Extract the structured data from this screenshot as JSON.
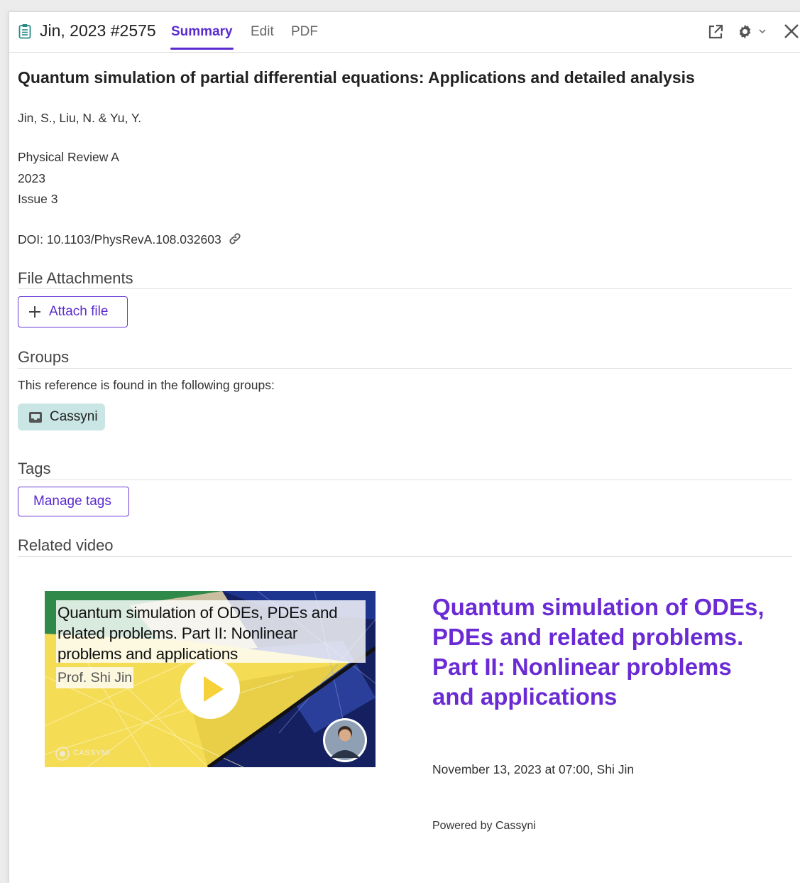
{
  "header": {
    "ref_title": "Jin, 2023 #2575",
    "tabs": [
      {
        "label": "Summary",
        "active": true
      },
      {
        "label": "Edit",
        "active": false
      },
      {
        "label": "PDF",
        "active": false
      }
    ],
    "icons": [
      "open-external-icon",
      "gear-icon",
      "chevron-down-icon",
      "close-icon"
    ]
  },
  "reference": {
    "title": "Quantum simulation of partial differential equations: Applications and detailed analysis",
    "authors": "Jin, S., Liu, N. & Yu, Y.",
    "journal": "Physical Review A",
    "year": "2023",
    "issue": "Issue 3",
    "doi": "DOI: 10.1103/PhysRevA.108.032603"
  },
  "attachments": {
    "heading": "File Attachments",
    "button": "Attach file"
  },
  "groups": {
    "heading": "Groups",
    "description": "This reference is found in the following groups:",
    "items": [
      "Cassyni"
    ]
  },
  "tags": {
    "heading": "Tags",
    "button": "Manage tags"
  },
  "video": {
    "heading": "Related video",
    "thumb_caption": "Quantum simulation of ODEs, PDEs and related problems. Part II: Nonlinear problems and applications",
    "thumb_author": "Prof. Shi Jin",
    "thumb_logo": "CASSYNI",
    "title": "Quantum simulation of ODEs, PDEs and related problems. Part II: Nonlinear problems and applications",
    "date_author": "November 13, 2023 at 07:00, Shi Jin",
    "powered_by": "Powered by Cassyni"
  },
  "colors": {
    "accent": "#5a2bd0",
    "chip_bg": "#c9e6e4"
  }
}
